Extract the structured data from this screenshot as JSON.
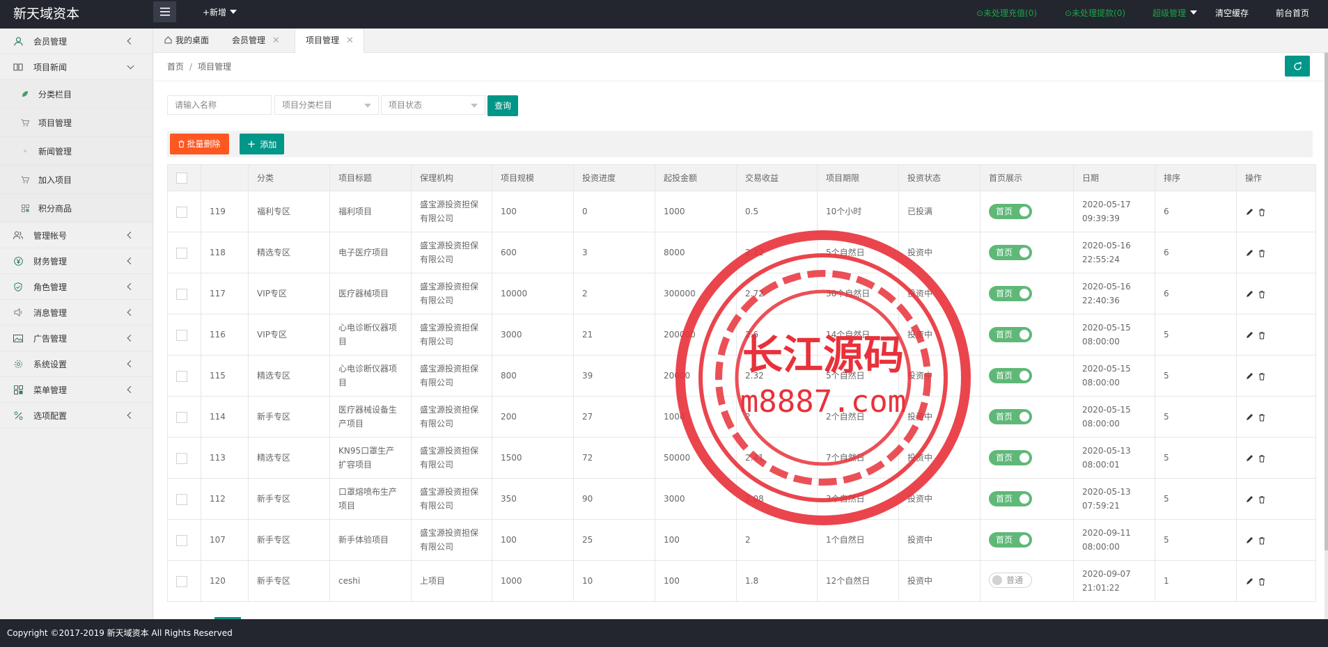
{
  "app": {
    "logo": "新天域资本",
    "add_new": "+新增",
    "links": {
      "recharge": "⊙未处理充值(0)",
      "withdraw": "⊙未处理提款(0)",
      "admin": "超级管理",
      "clear_cache": "清空缓存",
      "front_home": "前台首页"
    }
  },
  "sidebar": {
    "items": [
      {
        "label": "会员管理",
        "icon": "user-icon"
      },
      {
        "label": "项目新闻",
        "icon": "book-icon",
        "expanded": true
      },
      {
        "label": "分类栏目",
        "icon": "leaf-icon",
        "sub": true
      },
      {
        "label": "项目管理",
        "icon": "cart-icon",
        "sub": true
      },
      {
        "label": "新闻管理",
        "icon": "dot-icon",
        "sub": true
      },
      {
        "label": "加入项目",
        "icon": "cart-icon",
        "sub": true
      },
      {
        "label": "积分商品",
        "icon": "grid-icon",
        "sub": true
      },
      {
        "label": "管理帐号",
        "icon": "users-icon"
      },
      {
        "label": "财务管理",
        "icon": "yen-icon"
      },
      {
        "label": "角色管理",
        "icon": "shield-icon"
      },
      {
        "label": "消息管理",
        "icon": "speaker-icon"
      },
      {
        "label": "广告管理",
        "icon": "image-icon"
      },
      {
        "label": "系统设置",
        "icon": "gear-icon"
      },
      {
        "label": "菜单管理",
        "icon": "menu-grid-icon"
      },
      {
        "label": "选项配置",
        "icon": "config-icon"
      }
    ]
  },
  "tabs": [
    {
      "label": "我的桌面",
      "icon": "home-icon"
    },
    {
      "label": "会员管理",
      "close": "✕"
    },
    {
      "label": "项目管理",
      "close": "✕",
      "active": true
    }
  ],
  "breadcrumb": {
    "home": "首页",
    "sep": "/",
    "current": "项目管理"
  },
  "filters": {
    "name_placeholder": "请输入名称",
    "category": "项目分类栏目",
    "status": "项目状态",
    "query": "查询"
  },
  "toolbar": {
    "batch_delete": "批量删除",
    "add": "添加"
  },
  "table": {
    "headers": [
      "分类",
      "项目标题",
      "保理机构",
      "项目规模",
      "投资进度",
      "起投金额",
      "交易收益",
      "项目期限",
      "投资状态",
      "首页展示",
      "日期",
      "排序",
      "操作"
    ],
    "rows": [
      {
        "id": "119",
        "cat": "福利专区",
        "title": "福利项目",
        "org": "盛宝源投资担保有限公司",
        "scale": "100",
        "progress": "0",
        "min": "1000",
        "yield": "0.5",
        "term": "10个小时",
        "status": "已投满",
        "home": "首页",
        "home_on": true,
        "date": "2020-05-17 09:39:39",
        "sort": "6"
      },
      {
        "id": "118",
        "cat": "精选专区",
        "title": "电子医疗项目",
        "org": "盛宝源投资担保有限公司",
        "scale": "600",
        "progress": "3",
        "min": "8000",
        "yield": "2.22",
        "term": "5个自然日",
        "status": "投资中",
        "home": "首页",
        "home_on": true,
        "date": "2020-05-16 22:55:24",
        "sort": "6"
      },
      {
        "id": "117",
        "cat": "VIP专区",
        "title": "医疗器械项目",
        "org": "盛宝源投资担保有限公司",
        "scale": "10000",
        "progress": "2",
        "min": "300000",
        "yield": "2.72",
        "term": "30个自然日",
        "status": "投资中",
        "home": "首页",
        "home_on": true,
        "date": "2020-05-16 22:40:36",
        "sort": "6"
      },
      {
        "id": "116",
        "cat": "VIP专区",
        "title": "心电诊断仪器项目",
        "org": "盛宝源投资担保有限公司",
        "scale": "3000",
        "progress": "21",
        "min": "200000",
        "yield": "2.6",
        "term": "14个自然日",
        "status": "投资中",
        "home": "首页",
        "home_on": true,
        "date": "2020-05-15 08:00:00",
        "sort": "5"
      },
      {
        "id": "115",
        "cat": "精选专区",
        "title": "心电诊断仪器项目",
        "org": "盛宝源投资担保有限公司",
        "scale": "800",
        "progress": "39",
        "min": "20000",
        "yield": "2.32",
        "term": "5个自然日",
        "status": "投资中",
        "home": "首页",
        "home_on": true,
        "date": "2020-05-15 08:00:00",
        "sort": "5"
      },
      {
        "id": "114",
        "cat": "新手专区",
        "title": "医疗器械设备生产项目",
        "org": "盛宝源投资担保有限公司",
        "scale": "200",
        "progress": "27",
        "min": "1000",
        "yield": "2",
        "term": "2个自然日",
        "status": "投资中",
        "home": "首页",
        "home_on": true,
        "date": "2020-05-15 08:00:00",
        "sort": "5"
      },
      {
        "id": "113",
        "cat": "精选专区",
        "title": "KN95口罩生产扩容项目",
        "org": "盛宝源投资担保有限公司",
        "scale": "1500",
        "progress": "72",
        "min": "50000",
        "yield": "2.41",
        "term": "7个自然日",
        "status": "投资中",
        "home": "首页",
        "home_on": true,
        "date": "2020-05-13 08:00:01",
        "sort": "5"
      },
      {
        "id": "112",
        "cat": "新手专区",
        "title": "口罩熔喷布生产项目",
        "org": "盛宝源投资担保有限公司",
        "scale": "350",
        "progress": "90",
        "min": "3000",
        "yield": "2.08",
        "term": "3个自然日",
        "status": "投资中",
        "home": "首页",
        "home_on": true,
        "date": "2020-05-13 07:59:21",
        "sort": "5"
      },
      {
        "id": "107",
        "cat": "新手专区",
        "title": "新手体验项目",
        "org": "盛宝源投资担保有限公司",
        "scale": "100",
        "progress": "25",
        "min": "100",
        "yield": "2",
        "term": "1个自然日",
        "status": "投资中",
        "home": "首页",
        "home_on": true,
        "date": "2020-09-11 08:00:00",
        "sort": "5"
      },
      {
        "id": "120",
        "cat": "新手专区",
        "title": "ceshi",
        "org": "上项目",
        "scale": "1000",
        "progress": "10",
        "min": "100",
        "yield": "1.8",
        "term": "12个自然日",
        "status": "投资中",
        "home": "普通",
        "home_on": false,
        "date": "2020-09-07 21:01:22",
        "sort": "1"
      }
    ]
  },
  "watermark": {
    "cn": "长江源码",
    "url": "m8887.com"
  },
  "footer": "Copyright ©2017-2019 新天域资本 All Rights Reserved",
  "colors": {
    "accent": "#009688",
    "danger": "#ff5722",
    "switch_on": "#5fb878",
    "topbar": "#23262e",
    "watermark": "#e8313a"
  }
}
